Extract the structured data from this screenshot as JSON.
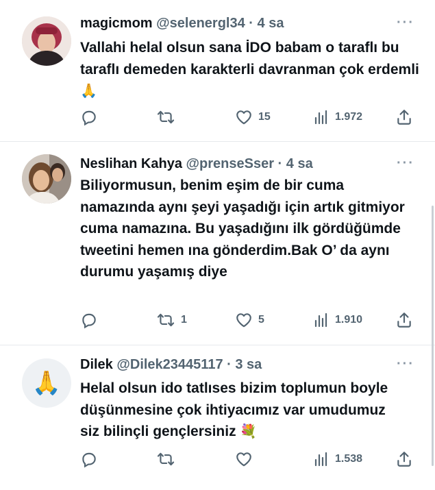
{
  "tweets": [
    {
      "name": "magicmom",
      "handle": "@selenergl34",
      "time": "4 sa",
      "text": "Vallahi helal olsun sana İDO babam o taraflı bu taraflı demeden karakterli davranman çok erdemli",
      "emoji": "🙏",
      "reply_count": "",
      "retweet_count": "",
      "like_count": "15",
      "view_count": "1.972"
    },
    {
      "name": "Neslihan Kahya",
      "handle": "@prenseSser",
      "time": "4 sa",
      "text": "Biliyormusun, benim eşim de bir cuma namazında aynı şeyi yaşadığı için artık gitmiyor cuma namazına. Bu yaşadığını ilk gördüğümde tweetini hemen ına gönderdim.Bak O’ da aynı durumu yaşamış diye",
      "emoji": "",
      "reply_count": "",
      "retweet_count": "1",
      "like_count": "5",
      "view_count": "1.910"
    },
    {
      "name": "Dilek",
      "handle": "@Dilek23445117",
      "time": "3 sa",
      "text": "Helal olsun ido tatlıses bizim toplumun boyle düşünmesine çok ihtiyacımız var umudumuz siz bilinçli gençlersiniz",
      "emoji": "💐",
      "avatar_emoji": "🙏",
      "reply_count": "",
      "retweet_count": "",
      "like_count": "",
      "view_count": "1.538"
    }
  ],
  "separator": " · ",
  "more_label": "···",
  "colors": {
    "text": "#0f1419",
    "muted": "#536471",
    "border": "#e6e9ec"
  },
  "icons": [
    "reply-icon",
    "retweet-icon",
    "like-icon",
    "views-icon",
    "share-icon",
    "more-icon"
  ]
}
